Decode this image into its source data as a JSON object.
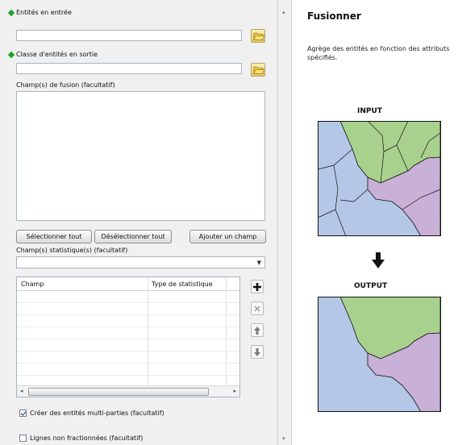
{
  "form": {
    "input_features": {
      "label": "Entités en entrée",
      "value": ""
    },
    "output_class": {
      "label": "Classe d'entités en sortie",
      "value": ""
    },
    "dissolve_fields": {
      "label": "Champ(s) de fusion (facultatif)"
    },
    "buttons": {
      "select_all": "Sélectionner tout",
      "unselect_all": "Désélectionner tout",
      "add_field": "Ajouter un champ"
    },
    "statistics": {
      "label": "Champ(s) statistique(s) (facultatif)",
      "dropdown_value": "",
      "columns": [
        "Champ",
        "Type de statistique"
      ],
      "rows": []
    },
    "checkbox_multipart": {
      "label": "Créer des entités multi-parties (facultatif)",
      "checked": true
    },
    "checkbox_unsplit": {
      "label": "Lignes non fractionnées (facultatif)",
      "checked": false
    }
  },
  "help": {
    "title": "Fusionner",
    "description": "Agrège des entités en fonction des attributs spécifiés.",
    "input_caption": "INPUT",
    "output_caption": "OUTPUT",
    "colors": {
      "green": "#a9d18e",
      "blue": "#b4c7e7",
      "purple": "#c9b0d6"
    }
  },
  "icons": [
    "folder-open-icon",
    "plus-icon",
    "remove-icon",
    "arrow-up-icon",
    "arrow-down-icon",
    "arrow-down-big-icon"
  ]
}
